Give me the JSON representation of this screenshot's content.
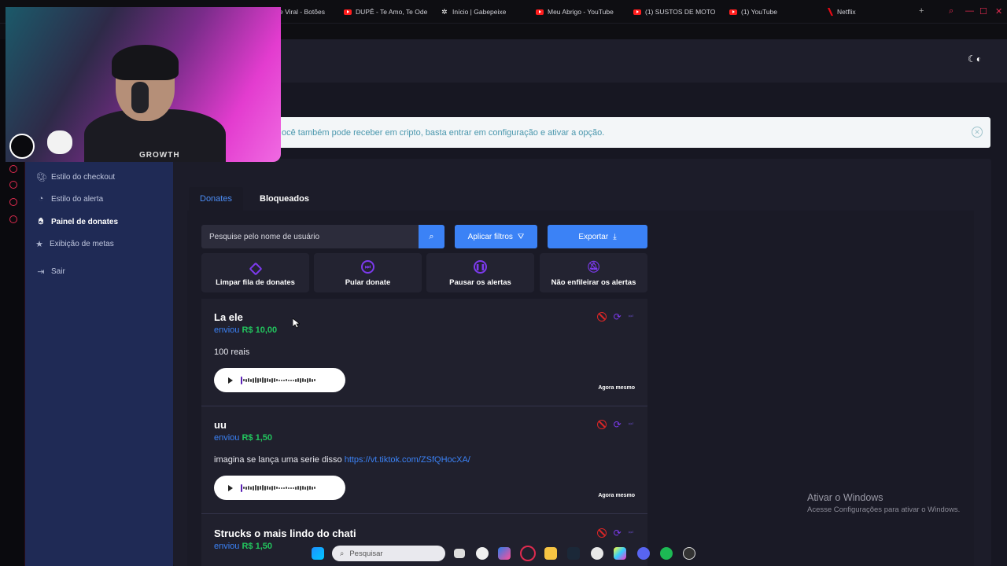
{
  "browser": {
    "tabs": [
      {
        "label": "e Viral - Botões",
        "icon": "youtube-icon"
      },
      {
        "label": "DUPÊ - Te Amo, Te Ode",
        "icon": "youtube-icon"
      },
      {
        "label": "Início | Gabepeixe",
        "icon": "site-icon"
      },
      {
        "label": "Meu Abrigo - YouTube",
        "icon": "youtube-icon"
      },
      {
        "label": "(1) SUSTOS DE MOTO",
        "icon": "youtube-icon"
      },
      {
        "label": "(1) YouTube",
        "icon": "youtube-icon"
      },
      {
        "label": "Netflix",
        "icon": "netflix-icon"
      }
    ]
  },
  "sidebar": {
    "items": [
      {
        "label": "Estilo do checkout",
        "icon": "palette-icon"
      },
      {
        "label": "Estilo do alerta",
        "icon": "palette-icon"
      },
      {
        "label": "Painel de donates",
        "icon": "hand-donate-icon",
        "active": true
      },
      {
        "label": "Exibição de metas",
        "icon": "star-icon"
      },
      {
        "label": "Sair",
        "icon": "logout-icon"
      }
    ]
  },
  "notice": {
    "text": "ocê também pode receber em cripto, basta entrar em configuração e ativar a opção."
  },
  "tabs": {
    "donates": "Donates",
    "blocked": "Bloqueados"
  },
  "toolbar": {
    "search_placeholder": "Pesquise pelo nome de usuário",
    "apply_filters": "Aplicar filtros",
    "export": "Exportar"
  },
  "actions": [
    {
      "label": "Limpar fila de donates",
      "icon": "eraser-icon"
    },
    {
      "label": "Pular donate",
      "icon": "skip-icon"
    },
    {
      "label": "Pausar os alertas",
      "icon": "pause-icon"
    },
    {
      "label": "Não enfileirar os alertas",
      "icon": "bell-off-icon"
    }
  ],
  "donations": [
    {
      "name": "La ele",
      "sent_label": "enviou",
      "amount": "R$ 10,00",
      "message": "100 reais",
      "link": "",
      "time": "Agora mesmo"
    },
    {
      "name": "uu",
      "sent_label": "enviou",
      "amount": "R$ 1,50",
      "message": "imagina se lança uma serie disso ",
      "link": "https://vt.tiktok.com/ZSfQHocXA/",
      "time": "Agora mesmo"
    },
    {
      "name": "Strucks o mais lindo do chati",
      "sent_label": "enviou",
      "amount": "R$ 1,50",
      "message": "",
      "link": "",
      "time": ""
    }
  ],
  "windows": {
    "activate_title": "Ativar o Windows",
    "activate_sub": "Acesse Configurações para ativar o Windows.",
    "taskbar_search": "Pesquisar"
  },
  "webcam": {
    "shirt_text": "GROWTH"
  },
  "colors": {
    "accent": "#3b82f6",
    "amount": "#22c55e",
    "sidebar": "#1f2a55",
    "gx": "#e02b4f",
    "icon_purple": "#7c3aed"
  }
}
